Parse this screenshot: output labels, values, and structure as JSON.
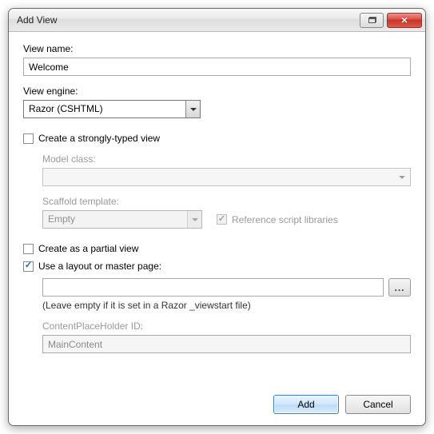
{
  "window": {
    "title": "Add View"
  },
  "fields": {
    "viewNameLabel": "View name:",
    "viewNameValue": "Welcome",
    "viewEngineLabel": "View engine:",
    "viewEngineValue": "Razor (CSHTML)"
  },
  "stronglyTyped": {
    "label": "Create a strongly-typed view",
    "checked": false,
    "modelClassLabel": "Model class:",
    "modelClassValue": "",
    "scaffoldLabel": "Scaffold template:",
    "scaffoldValue": "Empty",
    "referenceLabel": "Reference script libraries",
    "referenceChecked": true
  },
  "partial": {
    "label": "Create as a partial view",
    "checked": false
  },
  "layout": {
    "label": "Use a layout or master page:",
    "checked": true,
    "pathValue": "",
    "hint": "(Leave empty if it is set in a Razor _viewstart file)",
    "placeholderLabel": "ContentPlaceHolder ID:",
    "placeholderValue": "MainContent",
    "browseLabel": "..."
  },
  "buttons": {
    "add": "Add",
    "cancel": "Cancel"
  }
}
